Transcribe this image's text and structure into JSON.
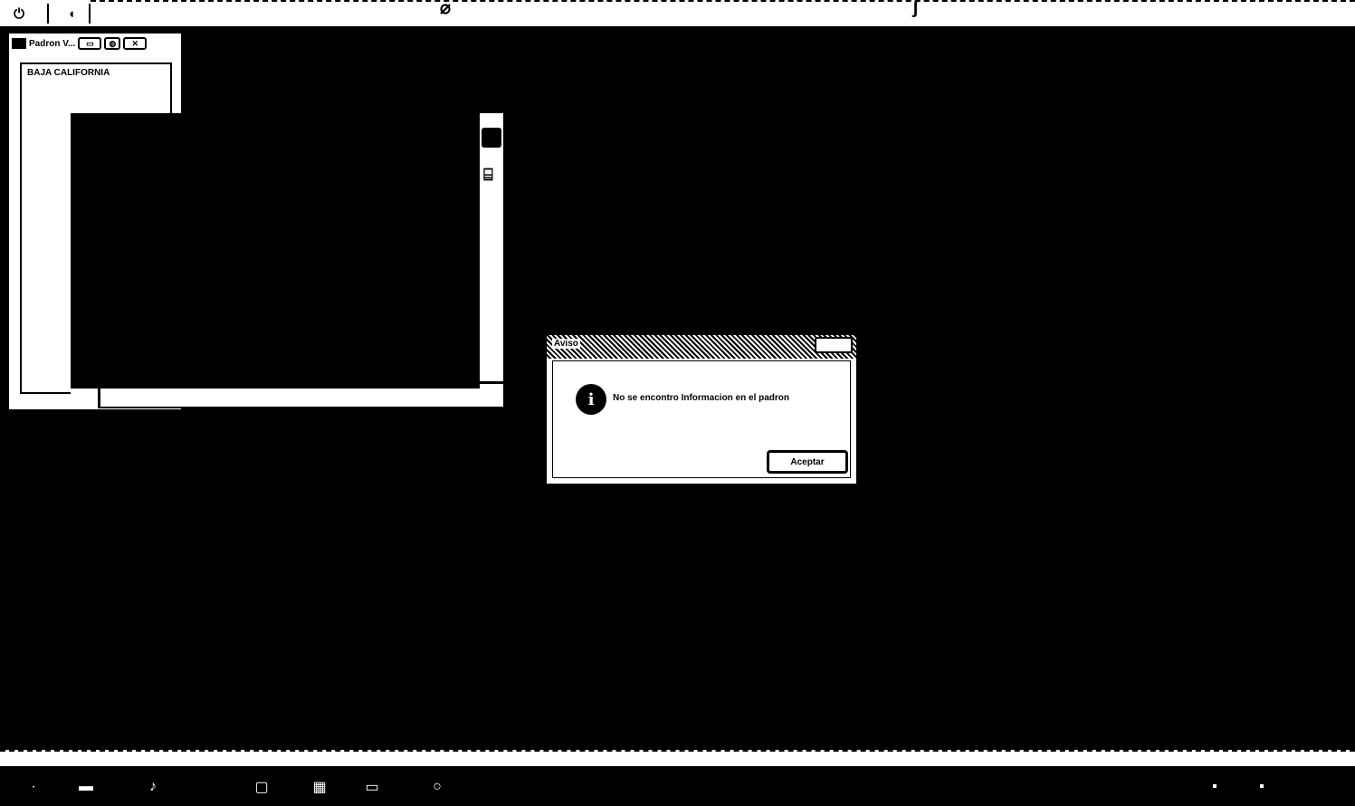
{
  "toolbar": {
    "icons": [
      "power-icon",
      "door-exit-icon"
    ],
    "power_glyph": "⏻",
    "exit_glyph": "◖"
  },
  "main_window": {
    "title": "Padron V...",
    "buttons": [
      "minimize",
      "restore",
      "close"
    ],
    "list_items": [
      "BAJA CALIFORNIA"
    ]
  },
  "dialog": {
    "title": "Aviso",
    "icon": "info-icon",
    "message": "No se encontro Informacion en el padron",
    "ok_label": "Aceptar"
  },
  "status_bar": {
    "text": ""
  },
  "taskbar": {
    "icons": [
      "start-icon",
      "printer-icon",
      "music-icon",
      "window-icon",
      "network-icon",
      "monitor-icon",
      "search-icon"
    ]
  }
}
